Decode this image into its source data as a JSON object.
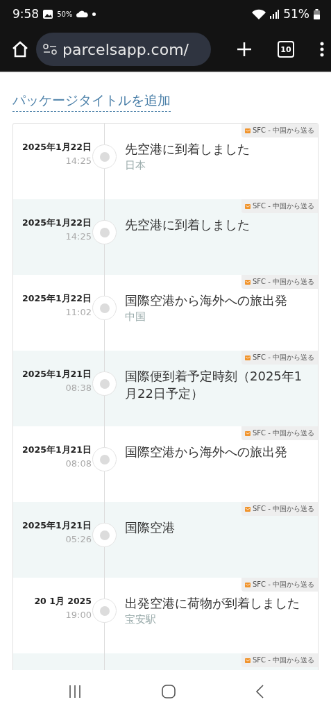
{
  "status_bar": {
    "time": "9:58",
    "weather_badge": "50%",
    "battery": "51%"
  },
  "browser": {
    "url": "parcelsapp.com/",
    "tab_count": "10"
  },
  "page": {
    "title_link": "パッケージタイトルを追加",
    "events": [
      {
        "date": "2025年1月22日",
        "time": "14:25",
        "status": "先空港に到着しました",
        "location": "日本",
        "source": "SFC - 中国から送る"
      },
      {
        "date": "2025年1月22日",
        "time": "14:25",
        "status": "先空港に到着しました",
        "source": "SFC - 中国から送る"
      },
      {
        "date": "2025年1月22日",
        "time": "11:02",
        "status": "国際空港から海外への旅出発",
        "location": "中国",
        "source": "SFC - 中国から送る"
      },
      {
        "date": "2025年1月21日",
        "time": "08:38",
        "status": "国際便到着予定時刻（2025年1月22日予定）",
        "source": "SFC - 中国から送る"
      },
      {
        "date": "2025年1月21日",
        "time": "08:08",
        "status": "国際空港から海外への旅出発",
        "source": "SFC - 中国から送る"
      },
      {
        "date": "2025年1月21日",
        "time": "05:26",
        "status": "国際空港",
        "source": "SFC - 中国から送る"
      },
      {
        "date": "20 1月 2025",
        "time": "19:00",
        "status": "出発空港に荷物が到着しました",
        "location": "宝安駅",
        "source": "SFC - 中国から送る"
      },
      {
        "source": "SFC - 中国から送る"
      }
    ]
  }
}
